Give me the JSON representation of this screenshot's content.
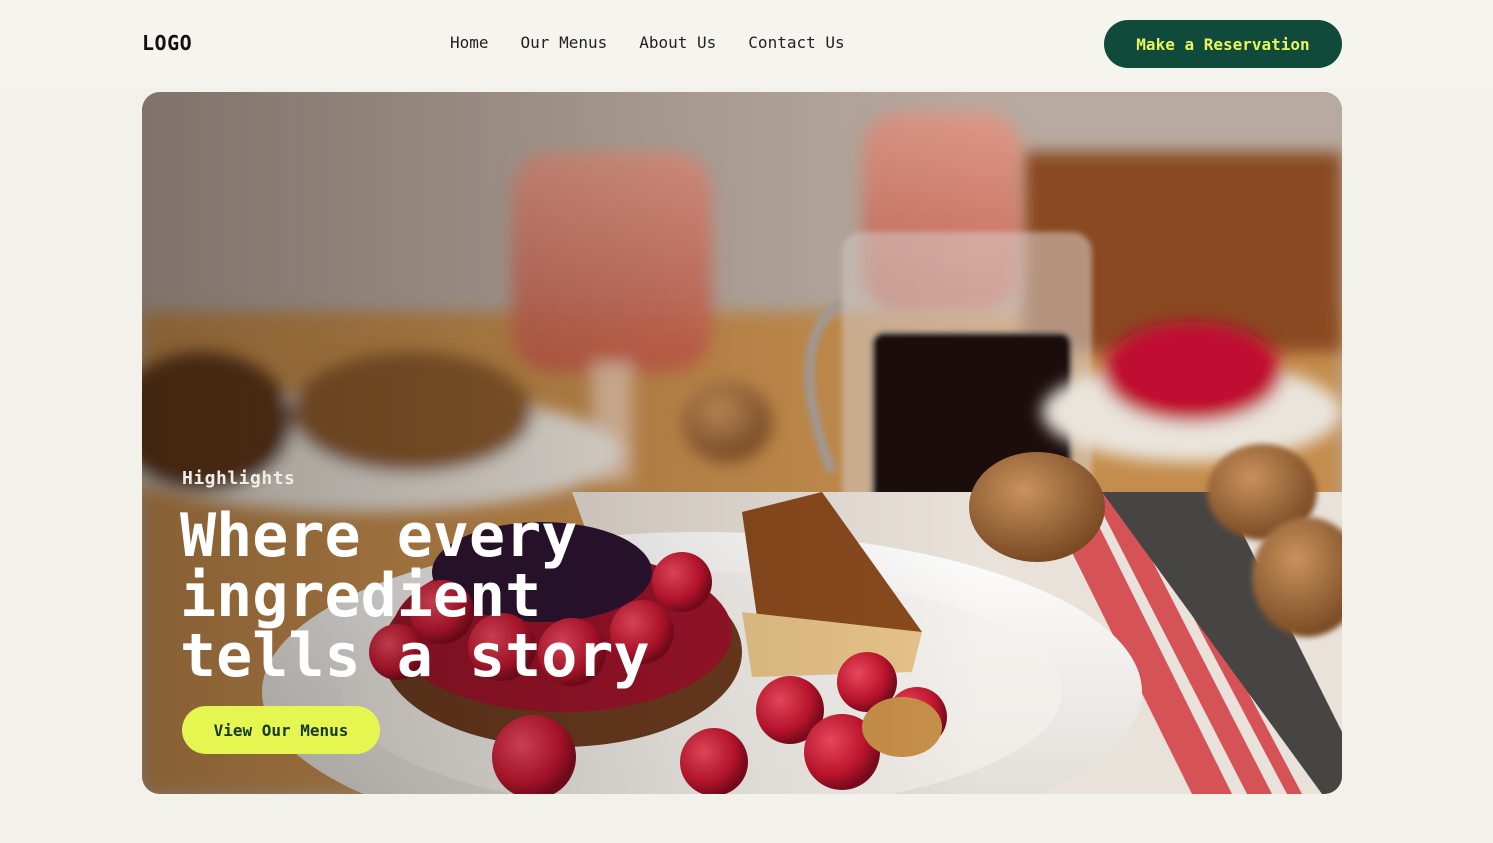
{
  "header": {
    "logo": "LOGO",
    "nav": [
      {
        "label": "Home"
      },
      {
        "label": "Our Menus"
      },
      {
        "label": "About Us"
      },
      {
        "label": "Contact Us"
      }
    ],
    "cta_label": "Make a Reservation"
  },
  "hero": {
    "eyebrow": "Highlights",
    "title": "Where every ingredient tells a story",
    "cta_label": "View Our Menus",
    "image_subject": "dessert-plate-with-berry-tart-and-caramel-pie"
  },
  "colors": {
    "page_bg": "#f3f2ea",
    "brand_green": "#0f4a3a",
    "accent_lime": "#e6f650",
    "reserve_text": "#e8f55a"
  }
}
